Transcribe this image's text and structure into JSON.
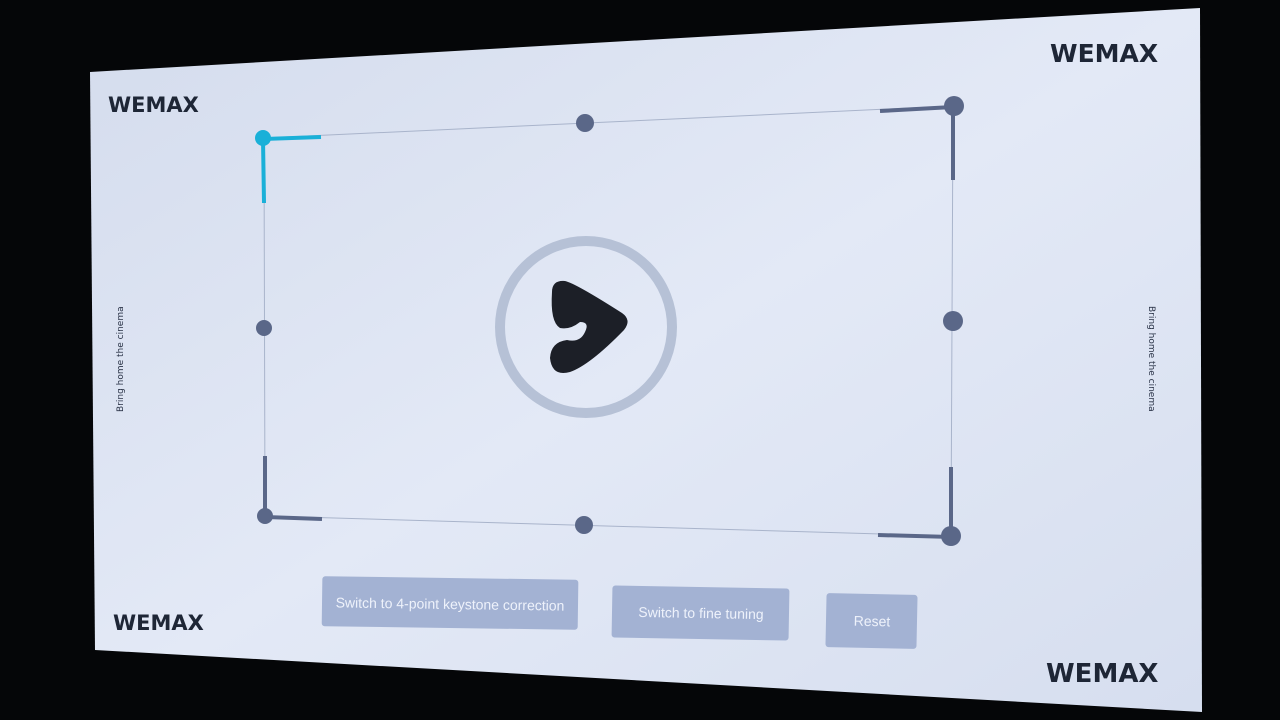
{
  "brand": {
    "top_left": "WEMAX",
    "top_right": "WEMAX",
    "bottom_left": "WEMAX",
    "bottom_right": "WEMAX"
  },
  "tagline": {
    "left": "Bring home the cinema",
    "right": "Bring home the cinema"
  },
  "keystone": {
    "selected_corner": "top-left",
    "accent_color": "#1ab0d8",
    "handle_color": "#5a6788"
  },
  "center_logo": "play-logo-icon",
  "buttons": {
    "four_point": "Switch to 4-point keystone correction",
    "fine_tuning": "Switch to fine tuning",
    "reset": "Reset"
  }
}
